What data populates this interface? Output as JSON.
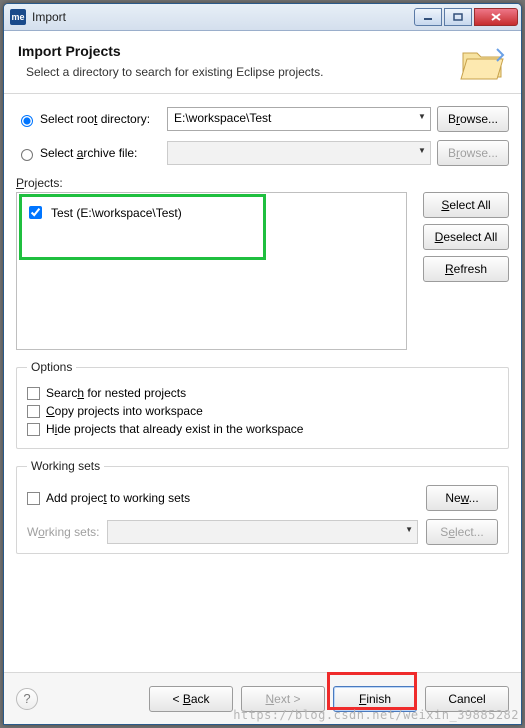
{
  "window": {
    "app_icon": "me",
    "title": "Import"
  },
  "header": {
    "title": "Import Projects",
    "subtitle": "Select a directory to search for existing Eclipse projects."
  },
  "source": {
    "root_label_pre": "Select roo",
    "root_label_u": "t",
    "root_label_post": " directory:",
    "root_value": "E:\\workspace\\Test",
    "archive_label_pre": "Select ",
    "archive_label_u": "a",
    "archive_label_post": "rchive file:",
    "archive_value": "",
    "browse": "B",
    "browse_u": "r",
    "browse_post": "owse..."
  },
  "projects": {
    "label_u": "P",
    "label_post": "rojects:",
    "items": [
      {
        "checked": true,
        "label": "Test (E:\\workspace\\Test)"
      }
    ],
    "select_all_u": "S",
    "select_all_post": "elect All",
    "deselect_all_u": "D",
    "deselect_all_post": "eselect All",
    "refresh_u": "R",
    "refresh_post": "efresh"
  },
  "options": {
    "legend": "Options",
    "nested_pre": "Searc",
    "nested_u": "h",
    "nested_post": " for nested projects",
    "copy_u": "C",
    "copy_post": "opy projects into workspace",
    "hide_pre": "H",
    "hide_u": "i",
    "hide_post": "de projects that already exist in the workspace"
  },
  "working_sets": {
    "legend": "Working sets",
    "add_pre": "Add projec",
    "add_u": "t",
    "add_post": " to working sets",
    "new_pre": "Ne",
    "new_u": "w",
    "new_post": "...",
    "ws_label_pre": "W",
    "ws_label_u": "o",
    "ws_label_post": "rking sets:",
    "select_pre": "S",
    "select_u": "e",
    "select_post": "lect..."
  },
  "footer": {
    "back_pre": "< ",
    "back_u": "B",
    "back_post": "ack",
    "next_u": "N",
    "next_post": "ext >",
    "finish_u": "F",
    "finish_post": "inish",
    "cancel": "Cancel"
  },
  "watermark": "https://blog.csdn.net/weixin_39885282"
}
